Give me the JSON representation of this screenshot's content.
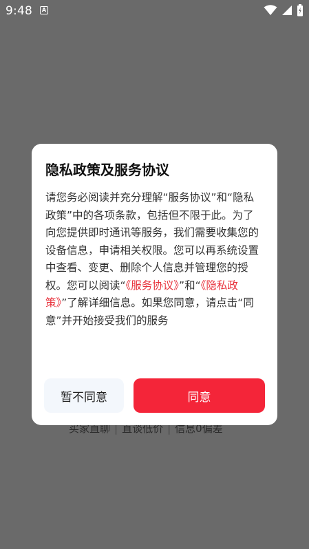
{
  "status_bar": {
    "time": "9:48",
    "notification_icon": "A",
    "icons": [
      "wifi-icon",
      "signal-icon",
      "battery-icon"
    ]
  },
  "background": {
    "features": [
      "买家直聊",
      "直谈低价",
      "信息0偏差"
    ],
    "separator": "|"
  },
  "dialog": {
    "title": "隐私政策及服务协议",
    "body_part1": "请您务必阅读并充分理解“服务协议”和“隐私政策”中的各项条款，包括但不限于此。为了向您提供即时通讯等服务，我们需要收集您的设备信息，申请相关权限。您可以再系统设置中查看、变更、删除个人信息并管理您的授权。您可以阅读“",
    "link_service": "《服务协议》",
    "and_text": "”和“",
    "link_privacy": "《隐私政策》",
    "body_part2": "”了解详细信息。如果您同意，请点击“同意”并开始接受我们的服务",
    "disagree_label": "暂不同意",
    "agree_label": "同意"
  },
  "colors": {
    "accent": "#f42539",
    "link": "#e8323c",
    "overlay": "#6a6a6a"
  }
}
